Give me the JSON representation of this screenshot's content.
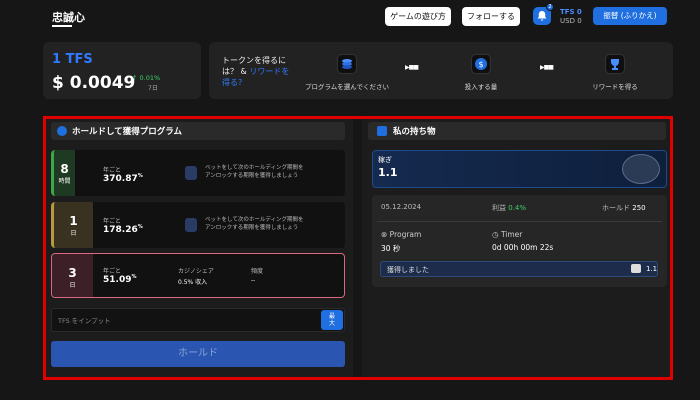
{
  "header": {
    "title": "忠誠心",
    "how_to_play": "ゲームの遊び方",
    "follow": "フォローする",
    "notification_count": "2",
    "wallet_tfs_label": "TFS",
    "wallet_tfs_value": "0",
    "wallet_usd_label": "USD",
    "wallet_usd_value": "0",
    "swap_button": "振替 (ふりかえ)"
  },
  "token": {
    "name": "1 TFS",
    "price": "$ 0.0049",
    "change": "0.01%",
    "period": "7日"
  },
  "steps": {
    "intro_line1": "トークンを得るに",
    "intro_line2_a": "は？ & ",
    "intro_link": "リワードを得る?",
    "items": [
      {
        "label": "プログラムを選んでください",
        "icon": "coin-stack-icon"
      },
      {
        "label": "投入する量",
        "icon": "dollar-coin-icon"
      },
      {
        "label": "リワードを得る",
        "icon": "trophy-icon"
      }
    ]
  },
  "hold_panel": {
    "title": "ホールドして獲得プログラム",
    "plans": [
      {
        "num": "8",
        "unit": "時間",
        "color": "#3ca64a",
        "per": "年ごと",
        "rate": "370.87",
        "rate_suffix": "%",
        "lock_text_1": "ベットをして次のホールディング期間を",
        "lock_text_2": "アンロックする期限を獲得しましょう"
      },
      {
        "num": "1",
        "unit": "日",
        "color": "#b89a3d",
        "per": "年ごと",
        "rate": "178.26",
        "rate_suffix": "%",
        "lock_text_1": "ベットをして次のホールディング期間を",
        "lock_text_2": "アンロックする期限を獲得しましょう"
      },
      {
        "num": "3",
        "unit": "日",
        "color": "#c9596e",
        "per": "年ごと",
        "rate": "51.09",
        "rate_suffix": "%",
        "casino_label": "カジノシェア",
        "casino_value": "0.5% 収入",
        "freq_label": "頻度",
        "freq_value": "--"
      }
    ],
    "input_placeholder": "TFS をインプット",
    "max_label_1": "最",
    "max_label_2": "大",
    "hold_button": "ホールド"
  },
  "holdings_panel": {
    "title": "私の持ち物",
    "earn_label": "稼ぎ",
    "earn_value": "1.1",
    "date": "05.12.2024",
    "profit_label": "利益",
    "profit_value": "0.4%",
    "hold_label": "ホールド",
    "hold_value": "250",
    "program_label": "Program",
    "program_value": "30 秒",
    "timer_label": "Timer",
    "timer_value": "0d 00h 00m 22s",
    "earned_label": "獲得しました",
    "earned_value": "1.1"
  },
  "colors": {
    "accent": "#1f6fe0",
    "positive": "#3fd26b",
    "highlight_frame": "#e00000"
  }
}
